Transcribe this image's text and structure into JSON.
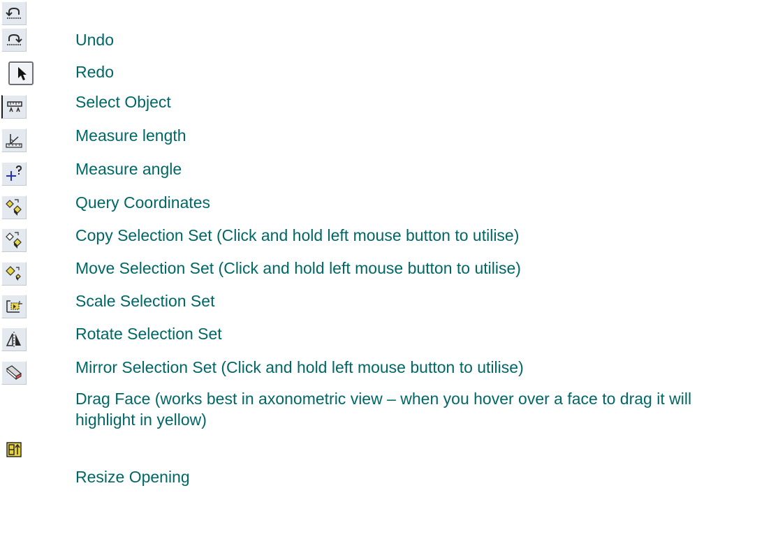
{
  "toolbar_items": [
    {
      "label": "Undo",
      "icon": "undo-icon"
    },
    {
      "label": "Redo",
      "icon": "redo-icon"
    },
    {
      "label": "Select Object",
      "icon": "select-arrow-icon"
    },
    {
      "label": "Measure length",
      "icon": "ruler-icon"
    },
    {
      "label": "Measure angle",
      "icon": "angle-ruler-icon"
    },
    {
      "label": "Query Coordinates",
      "icon": "crosshair-query-icon"
    },
    {
      "label": "Copy Selection Set (Click and hold left mouse button to utilise)",
      "icon": "copy-selection-icon"
    },
    {
      "label": "Move Selection Set (Click and hold left mouse button to utilise)",
      "icon": "move-selection-icon"
    },
    {
      "label": "Scale Selection Set",
      "icon": "scale-selection-icon"
    },
    {
      "label": "Rotate Selection Set",
      "icon": "rotate-selection-icon"
    },
    {
      "label": "Mirror Selection Set (Click and hold left mouse button to utilise)",
      "icon": "mirror-selection-icon"
    },
    {
      "label": "Drag Face (works best in axonometric view – when you hover over a face to drag it will highlight in yellow)",
      "icon": "drag-face-icon"
    },
    {
      "label": "Resize Opening",
      "icon": "resize-opening-icon"
    }
  ],
  "colors": {
    "label_text": "#006666",
    "icon_background": "#e4e8ef"
  }
}
